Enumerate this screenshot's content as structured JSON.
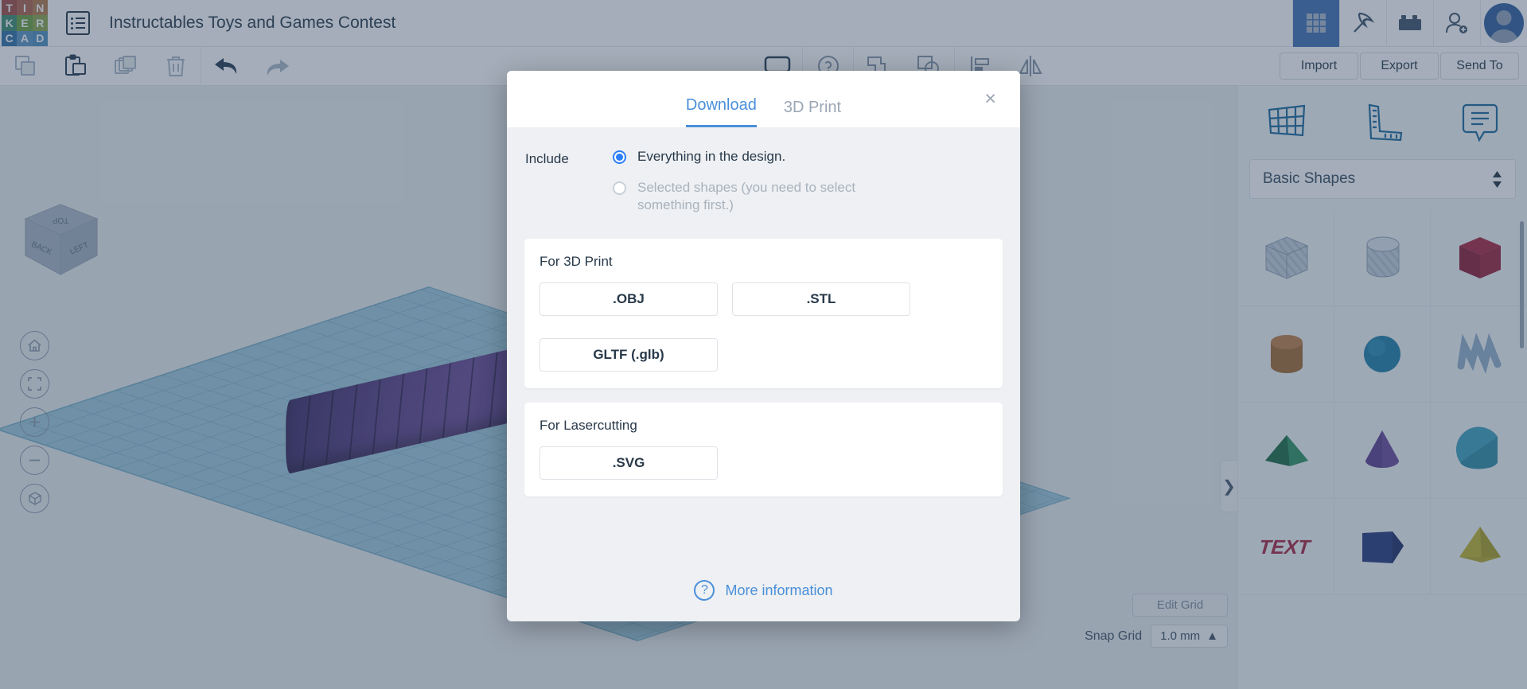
{
  "header": {
    "logo_letters": [
      "T",
      "I",
      "N",
      "K",
      "E",
      "R",
      "C",
      "A",
      "D"
    ],
    "logo_colors": [
      "#a04a42",
      "#b0614b",
      "#b2794a",
      "#3b8a6e",
      "#6aa03c",
      "#8aa64a",
      "#2f6fa8",
      "#5a94c4",
      "#4d8fc0"
    ],
    "menu_icon": "hamburger-list-icon",
    "doc_title": "Instructables Toys and Games Contest",
    "right_icons": [
      {
        "name": "blocks-grid-icon",
        "active": true
      },
      {
        "name": "minecraft-pickaxe-icon",
        "active": false
      },
      {
        "name": "lego-brick-icon",
        "active": false
      },
      {
        "name": "add-person-icon",
        "active": false
      }
    ],
    "avatar_name": "user-avatar"
  },
  "toolbar": {
    "left_icons": [
      {
        "name": "copy-icon",
        "dim": true
      },
      {
        "name": "paste-icon",
        "dim": false
      },
      {
        "name": "duplicate-icon",
        "dim": true
      },
      {
        "name": "delete-trash-icon",
        "dim": true
      }
    ],
    "history_icons": [
      {
        "name": "undo-icon",
        "dim": false
      },
      {
        "name": "redo-icon",
        "dim": true
      }
    ],
    "mid_icons": [
      {
        "name": "note-comment-icon"
      },
      {
        "name": "help-circle-icon"
      },
      {
        "name": "group-icon"
      },
      {
        "name": "ungroup-icon"
      },
      {
        "name": "align-icon"
      },
      {
        "name": "mirror-icon"
      }
    ],
    "import_label": "Import",
    "export_label": "Export",
    "send_to_label": "Send To"
  },
  "canvas": {
    "viewcube_faces": {
      "top": "TOP",
      "left_face": "BACK",
      "right_face": "LEFT"
    },
    "nav_buttons": [
      {
        "name": "home-view-icon"
      },
      {
        "name": "fit-to-view-icon"
      },
      {
        "name": "zoom-in-icon"
      },
      {
        "name": "zoom-out-icon"
      },
      {
        "name": "perspective-toggle-icon"
      }
    ],
    "edit_grid_label": "Edit Grid",
    "snap_grid_label": "Snap Grid",
    "snap_grid_value": "1.0 mm",
    "collapse_handle_glyph": "❯"
  },
  "right_panel": {
    "tools": [
      {
        "name": "workplane-icon"
      },
      {
        "name": "ruler-icon"
      },
      {
        "name": "note-icon"
      }
    ],
    "category_selected": "Basic Shapes",
    "shapes": [
      {
        "name": "box-hole-shape",
        "label": "Box (hole)"
      },
      {
        "name": "cylinder-hole-shape",
        "label": "Cylinder (hole)"
      },
      {
        "name": "box-shape",
        "label": "Box"
      },
      {
        "name": "cylinder-shape",
        "label": "Cylinder"
      },
      {
        "name": "sphere-shape",
        "label": "Sphere"
      },
      {
        "name": "scribble-shape",
        "label": "Scribble"
      },
      {
        "name": "wedge-shape",
        "label": "Wedge"
      },
      {
        "name": "cone-shape",
        "label": "Cone"
      },
      {
        "name": "roof-shape",
        "label": "Roof"
      },
      {
        "name": "text-shape",
        "label": "Text"
      },
      {
        "name": "polygon-shape",
        "label": "Polygon"
      },
      {
        "name": "pyramid-shape",
        "label": "Pyramid"
      }
    ]
  },
  "modal": {
    "tabs": [
      {
        "label": "Download",
        "active": true
      },
      {
        "label": "3D Print",
        "active": false
      }
    ],
    "close_glyph": "×",
    "include_label": "Include",
    "options": [
      {
        "text": "Everything in the design.",
        "selected": true,
        "disabled": false
      },
      {
        "text": "Selected shapes (you need to select something first.)",
        "selected": false,
        "disabled": true
      }
    ],
    "sections": [
      {
        "title": "For 3D Print",
        "buttons": [
          ".OBJ",
          ".STL",
          "GLTF (.glb)"
        ]
      },
      {
        "title": "For Lasercutting",
        "buttons": [
          ".SVG"
        ]
      }
    ],
    "more_info_label": "More information",
    "more_info_icon": "question-circle-icon",
    "accent_color": "#4a90d9",
    "radio_color": "#2d7ff9"
  }
}
